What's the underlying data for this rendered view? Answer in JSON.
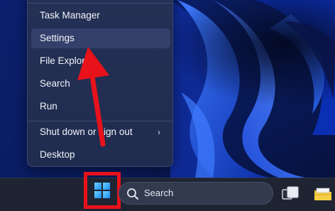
{
  "context_menu": {
    "items": [
      {
        "label": "Task Manager"
      },
      {
        "label": "Settings"
      },
      {
        "label": "File Explorer"
      },
      {
        "label": "Search"
      },
      {
        "label": "Run"
      },
      {
        "label": "Shut down or sign out",
        "chevron": "›"
      },
      {
        "label": "Desktop"
      }
    ],
    "highlighted_item": "Settings"
  },
  "taskbar": {
    "search_label": "Search",
    "start_icon": "windows-logo-icon",
    "search_icon": "magnifier-icon",
    "taskview_icon": "task-view-icon",
    "explorer_icon": "file-explorer-icon"
  },
  "annotations": {
    "arrow_color": "#e8121b",
    "highlight_box_color": "#e8121b"
  },
  "colors": {
    "menu_bg": "#232f52",
    "taskbar_bg": "#1f2433",
    "wallpaper_base": "#0a1a5c",
    "wallpaper_accent": "#1f5bff"
  }
}
